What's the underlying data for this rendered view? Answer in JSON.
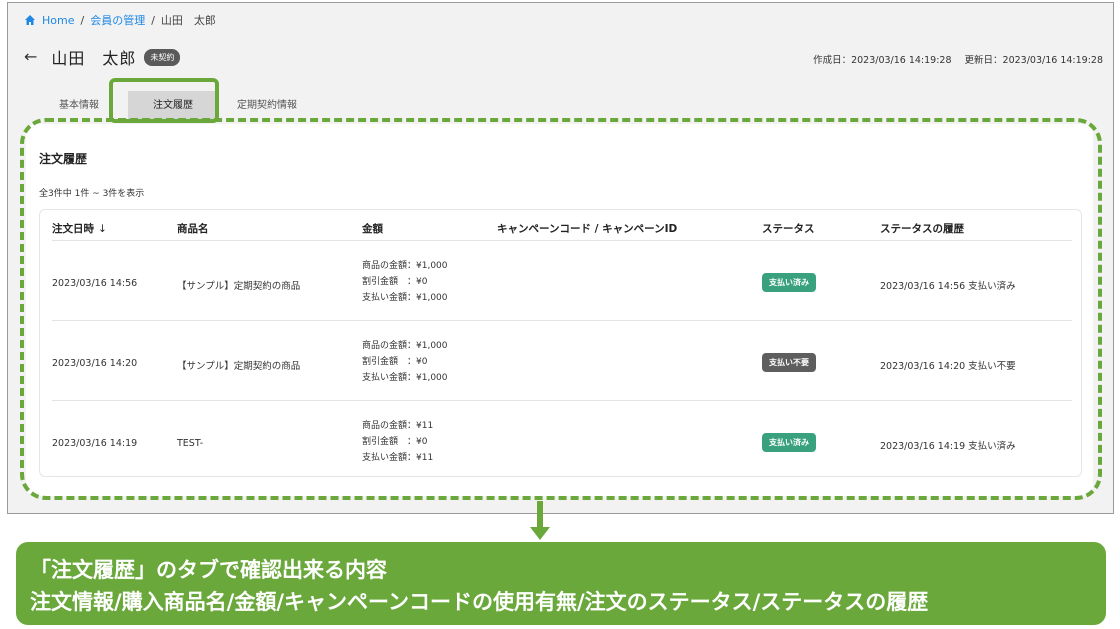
{
  "breadcrumb": {
    "home": "Home",
    "sep1": "/",
    "members": "会員の管理",
    "sep2": "/",
    "current": "山田　太郎"
  },
  "header": {
    "title": "山田　太郎",
    "contract_badge": "未契約",
    "created": "作成日：2023/03/16 14:19:28",
    "updated": "更新日：2023/03/16 14:19:28"
  },
  "tabs": [
    {
      "label": "基本情報"
    },
    {
      "label": "注文履歴"
    },
    {
      "label": "定期契約情報"
    }
  ],
  "orders": {
    "title": "注文履歴",
    "count_text": "全3件中 1件 ~ 3件を表示",
    "columns": {
      "datetime": "注文日時",
      "sort_icon": "↓",
      "product": "商品名",
      "amount": "金額",
      "campaign": "キャンペーンコード / キャンペーンID",
      "status": "ステータス",
      "history": "ステータスの履歴"
    },
    "rows": [
      {
        "datetime": "2023/03/16 14:56",
        "product": "【サンプル】定期契約の商品",
        "amount_product": "商品の金額：¥1,000",
        "amount_discount": "割引金額　：¥0",
        "amount_paid": "支払い金額：¥1,000",
        "campaign": "",
        "status": "支払い済み",
        "history": "2023/03/16 14:56 支払い済み"
      },
      {
        "datetime": "2023/03/16 14:20",
        "product": "【サンプル】定期契約の商品",
        "amount_product": "商品の金額：¥1,000",
        "amount_discount": "割引金額　：¥0",
        "amount_paid": "支払い金額：¥1,000",
        "campaign": "",
        "status": "支払い不要",
        "history": "2023/03/16 14:20 支払い不要"
      },
      {
        "datetime": "2023/03/16 14:19",
        "product": "TEST-",
        "amount_product": "商品の金額：¥11",
        "amount_discount": "割引金額　：¥0",
        "amount_paid": "支払い金額：¥11",
        "campaign": "",
        "status": "支払い済み",
        "history": "2023/03/16 14:19 支払い済み"
      }
    ]
  },
  "callout": {
    "line1": "「注文履歴」のタブで確認出来る内容",
    "line2": "注文情報/購入商品名/金額/キャンペーンコードの使用有無/注文のステータス/ステータスの履歴"
  },
  "colors": {
    "accent_green": "#6aa83c",
    "paid": "#3aa17e",
    "not_required": "#5e5e5e",
    "link": "#1e88e5"
  }
}
